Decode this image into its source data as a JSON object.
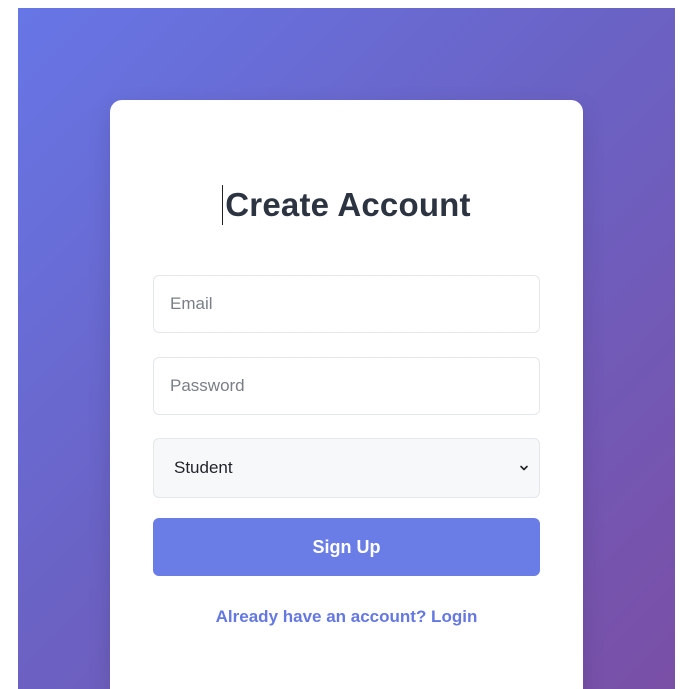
{
  "card": {
    "title": "Create Account"
  },
  "form": {
    "email_placeholder": "Email",
    "email_value": "",
    "password_placeholder": "Password",
    "password_value": "",
    "role_selected": "Student",
    "signup_label": "Sign Up",
    "login_link_label": "Already have an account? Login"
  },
  "colors": {
    "accent": "#6a7ce6",
    "link": "#6478e0",
    "background_start": "#6776e6",
    "background_end": "#7a4fa6"
  },
  "icons": {
    "select_chevron": "chevron-down-icon"
  }
}
